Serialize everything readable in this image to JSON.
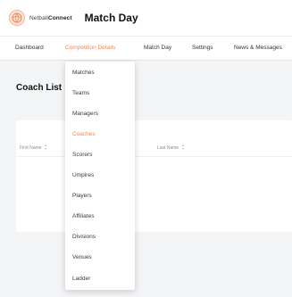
{
  "brand": {
    "name_prefix": "Netball",
    "name_suffix": "Connect",
    "app_title": "Match Day"
  },
  "nav": {
    "items": [
      {
        "label": "Dashboard"
      },
      {
        "label": "Competition Details"
      },
      {
        "label": "Match Day"
      },
      {
        "label": "Settings"
      },
      {
        "label": "News & Messages"
      }
    ]
  },
  "page": {
    "title": "Coach List"
  },
  "table": {
    "columns": [
      {
        "label": "First Name"
      },
      {
        "label": "Last Name"
      }
    ]
  },
  "dropdown": {
    "items": [
      {
        "label": "Matches"
      },
      {
        "label": "Teams"
      },
      {
        "label": "Managers"
      },
      {
        "label": "Coaches"
      },
      {
        "label": "Scorers"
      },
      {
        "label": "Umpires"
      },
      {
        "label": "Players"
      },
      {
        "label": "Affiliates"
      },
      {
        "label": "Divisions"
      },
      {
        "label": "Venues"
      },
      {
        "label": "Ladder"
      }
    ],
    "active_index": 3
  },
  "colors": {
    "accent": "#f0875a",
    "background": "#f4f5f7"
  }
}
